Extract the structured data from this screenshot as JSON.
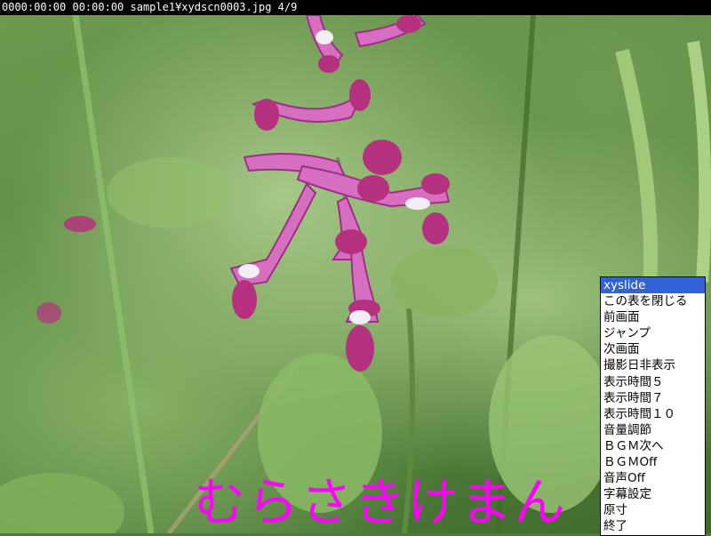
{
  "status_bar": {
    "text": "0000:00:00 00:00:00 sample1¥xydscn0003.jpg 4/9"
  },
  "caption": {
    "text": "むらさきけまん",
    "color": "#ff00ff"
  },
  "context_menu": {
    "items": [
      {
        "label": "xyslide",
        "selected": true
      },
      {
        "label": "この表を閉じる"
      },
      {
        "label": "前画面"
      },
      {
        "label": "ジャンプ"
      },
      {
        "label": "次画面"
      },
      {
        "label": "撮影日非表示"
      },
      {
        "label": "表示時間５"
      },
      {
        "label": "表示時間７"
      },
      {
        "label": "表示時間１０"
      },
      {
        "label": "音量調節"
      },
      {
        "label": "ＢＧＭ次へ"
      },
      {
        "label": "ＢＧＭOff"
      },
      {
        "label": "音声Off"
      },
      {
        "label": "字幕設定"
      },
      {
        "label": "原寸"
      },
      {
        "label": "終了"
      }
    ],
    "selected_color": "#3163d6"
  }
}
